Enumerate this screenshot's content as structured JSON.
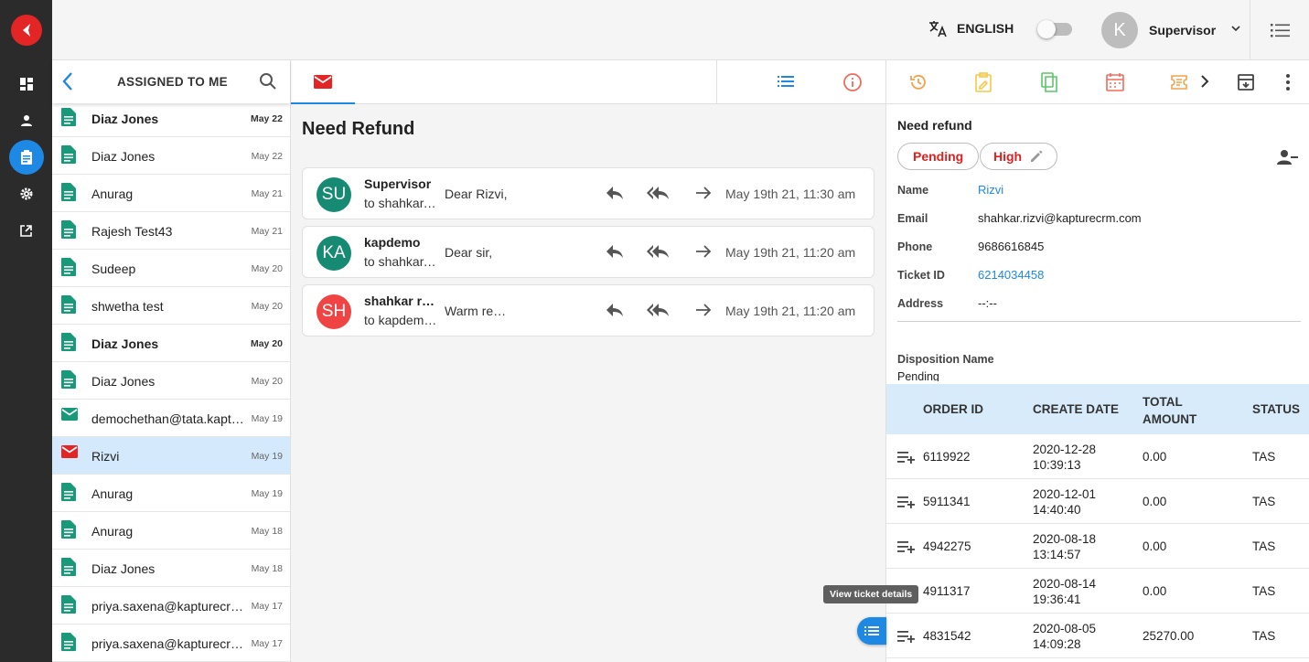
{
  "brand": {
    "accent": "#1e88e5",
    "logo_color": "#e32526"
  },
  "topbar": {
    "language": "ENGLISH",
    "user_initial": "K",
    "user_name": "Supervisor"
  },
  "list": {
    "title": "ASSIGNED TO ME",
    "items": [
      {
        "name": "Diaz Jones",
        "date": "May 22",
        "bold": true,
        "type": "doc"
      },
      {
        "name": "Diaz Jones",
        "date": "May 22",
        "bold": false,
        "type": "doc"
      },
      {
        "name": "Anurag",
        "date": "May 21",
        "bold": false,
        "type": "doc"
      },
      {
        "name": "Rajesh Test43",
        "date": "May 21",
        "bold": false,
        "type": "doc"
      },
      {
        "name": "Sudeep",
        "date": "May 20",
        "bold": false,
        "type": "doc"
      },
      {
        "name": "shwetha test",
        "date": "May 20",
        "bold": false,
        "type": "doc"
      },
      {
        "name": "Diaz Jones",
        "date": "May 20",
        "bold": true,
        "type": "doc"
      },
      {
        "name": "Diaz Jones",
        "date": "May 20",
        "bold": false,
        "type": "doc"
      },
      {
        "name": "demochethan@tata.kapturecrm.com",
        "date": "May 19",
        "bold": false,
        "type": "mail"
      },
      {
        "name": "Rizvi",
        "date": "May 19",
        "bold": false,
        "type": "mail-red",
        "selected": true
      },
      {
        "name": "Anurag",
        "date": "May 19",
        "bold": false,
        "type": "doc"
      },
      {
        "name": "Anurag",
        "date": "May 18",
        "bold": false,
        "type": "doc"
      },
      {
        "name": "Diaz Jones",
        "date": "May 18",
        "bold": false,
        "type": "doc"
      },
      {
        "name": "priya.saxena@kapturecrm.com",
        "date": "May 17",
        "bold": false,
        "type": "doc"
      },
      {
        "name": "priya.saxena@kapturecrm.com",
        "date": "May 17",
        "bold": false,
        "type": "doc"
      }
    ]
  },
  "thread": {
    "subject": "Need Refund",
    "emails": [
      {
        "initials": "SU",
        "avatar_color": "#178a73",
        "from": "Supervisor",
        "to": "to shahkar.rizvi@kapturecrm.com",
        "snippet": "Dear Rizvi,",
        "time": "May 19th 21, 11:30 am"
      },
      {
        "initials": "KA",
        "avatar_color": "#178a73",
        "from": "kapdemo",
        "to": "to shahkar.rizvi@kapturecrm.com",
        "snippet": "Dear sir,",
        "time": "May 19th 21, 11:20 am"
      },
      {
        "initials": "SH",
        "avatar_color": "#f04444",
        "from": "shahkar rizvi",
        "to": "to kapdemo@kapturecrm.com",
        "snippet": "Warm regards",
        "time": "May 19th 21, 11:20 am"
      }
    ],
    "tooltip": "View ticket details"
  },
  "ticket": {
    "title": "Need refund",
    "status": "Pending",
    "priority": "High",
    "fields": [
      {
        "label": "Name",
        "value": "Rizvi",
        "link": true
      },
      {
        "label": "Email",
        "value": "shahkar.rizvi@kapturecrm.com",
        "link": false
      },
      {
        "label": "Phone",
        "value": "9686616845",
        "link": false
      },
      {
        "label": "Ticket ID",
        "value": "6214034458",
        "link": true
      },
      {
        "label": "Address",
        "value": "--:--",
        "link": false
      }
    ],
    "disposition_label": "Disposition Name",
    "disposition_value": "Pending"
  },
  "orders": {
    "headers": {
      "order_id": "ORDER ID",
      "create_date": "CREATE DATE",
      "total_amount": "TOTAL AMOUNT",
      "status": "STATUS"
    },
    "rows": [
      {
        "id": "6119922",
        "date": "2020-12-28 10:39:13",
        "amount": "0.00",
        "status": "TAS"
      },
      {
        "id": "5911341",
        "date": "2020-12-01 14:40:40",
        "amount": "0.00",
        "status": "TAS"
      },
      {
        "id": "4942275",
        "date": "2020-08-18 13:14:57",
        "amount": "0.00",
        "status": "TAS"
      },
      {
        "id": "4911317",
        "date": "2020-08-14 19:36:41",
        "amount": "0.00",
        "status": "TAS"
      },
      {
        "id": "4831542",
        "date": "2020-08-05 14:09:28",
        "amount": "25270.00",
        "status": "TAS"
      }
    ]
  }
}
